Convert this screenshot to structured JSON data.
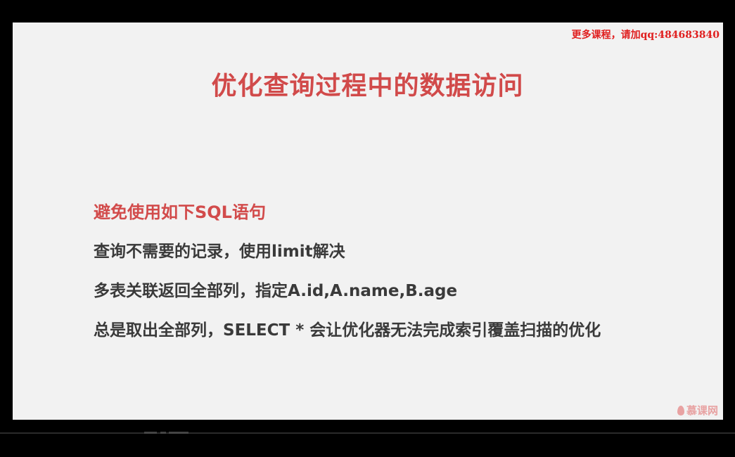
{
  "watermark": {
    "text": "更多课程，请加qq:484683840"
  },
  "slide": {
    "title": "优化查询过程中的数据访问",
    "heading": "避免使用如下SQL语句",
    "bullets": [
      "查询不需要的记录，使用limit解决",
      "多表关联返回全部列，指定A.id,A.name,B.age",
      "总是取出全部列，SELECT * 会让优化器无法完成索引覆盖扫描的优化"
    ]
  },
  "brand": {
    "logo_text": "慕课网",
    "icon": "flame-icon"
  },
  "colors": {
    "background": "#000000",
    "slide": "#f2f2f2",
    "title": "#d14a4a",
    "heading": "#d24b4b",
    "body_text": "#3a3a3a",
    "watermark": "#e02020"
  }
}
